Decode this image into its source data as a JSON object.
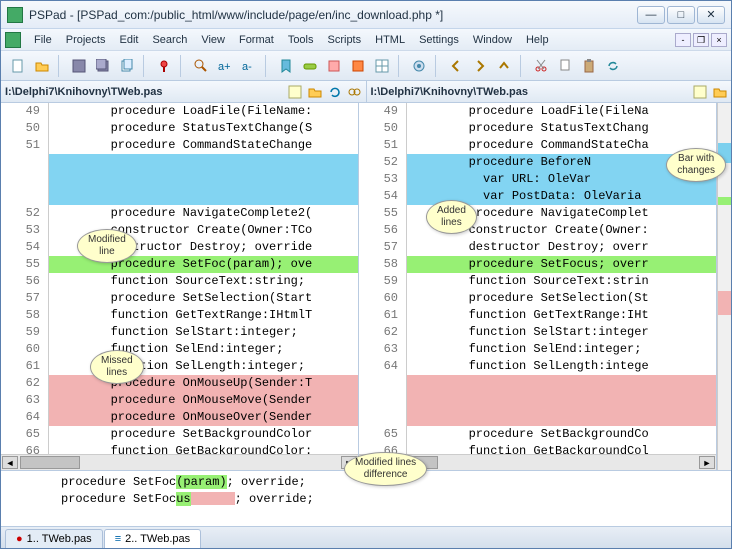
{
  "window": {
    "title": "PSPad - [PSPad_com:/public_html/www/include/page/en/inc_download.php *]"
  },
  "menu": {
    "items": [
      "File",
      "Projects",
      "Edit",
      "Search",
      "View",
      "Format",
      "Tools",
      "Scripts",
      "HTML",
      "Settings",
      "Window",
      "Help"
    ]
  },
  "paths": {
    "left": "I:\\Delphi7\\Knihovny\\TWeb.pas",
    "right": "I:\\Delphi7\\Knihovny\\TWeb.pas"
  },
  "left": {
    "lines": [
      {
        "n": "49",
        "t": "        procedure LoadFile(FileName:"
      },
      {
        "n": "50",
        "t": "        procedure StatusTextChange(S"
      },
      {
        "n": "51",
        "t": "        procedure CommandStateChange"
      },
      {
        "n": "",
        "t": " ",
        "cls": "hl-cyan"
      },
      {
        "n": "",
        "t": " ",
        "cls": "hl-cyan"
      },
      {
        "n": "",
        "t": " ",
        "cls": "hl-cyan"
      },
      {
        "n": "52",
        "t": "        procedure NavigateComplete2("
      },
      {
        "n": "53",
        "t": "        constructor Create(Owner:TCo"
      },
      {
        "n": "54",
        "t": "        destructor Destroy; override"
      },
      {
        "n": "55",
        "t": "        procedure SetFoc(param); ove",
        "cls": "hl-green"
      },
      {
        "n": "56",
        "t": "        function SourceText:string;"
      },
      {
        "n": "57",
        "t": "        procedure SetSelection(Start"
      },
      {
        "n": "58",
        "t": "        function GetTextRange:IHtmlT"
      },
      {
        "n": "59",
        "t": "        function SelStart:integer;"
      },
      {
        "n": "60",
        "t": "        function SelEnd:integer;"
      },
      {
        "n": "61",
        "t": "        function SelLength:integer;"
      },
      {
        "n": "62",
        "t": "        procedure OnMouseUp(Sender:T",
        "cls": "hl-pink"
      },
      {
        "n": "63",
        "t": "        procedure OnMouseMove(Sender",
        "cls": "hl-pink"
      },
      {
        "n": "64",
        "t": "        procedure OnMouseOver(Sender",
        "cls": "hl-pink"
      },
      {
        "n": "65",
        "t": "        procedure SetBackgroundColor"
      },
      {
        "n": "66",
        "t": "        function GetBackgroundColor:"
      }
    ]
  },
  "right": {
    "lines": [
      {
        "n": "49",
        "t": "        procedure LoadFile(FileNa"
      },
      {
        "n": "50",
        "t": "        procedure StatusTextChang"
      },
      {
        "n": "51",
        "t": "        procedure CommandStateCha"
      },
      {
        "n": "52",
        "t": "        procedure BeforeN",
        "cls": "hl-cyan"
      },
      {
        "n": "53",
        "t": "          var URL: OleVar",
        "cls": "hl-cyan"
      },
      {
        "n": "54",
        "t": "          var PostData: OleVaria",
        "cls": "hl-cyan"
      },
      {
        "n": "55",
        "t": "        procedure NavigateComplet"
      },
      {
        "n": "56",
        "t": "        constructor Create(Owner:"
      },
      {
        "n": "57",
        "t": "        destructor Destroy; overr"
      },
      {
        "n": "58",
        "t": "        procedure SetFocus; overr",
        "cls": "hl-green"
      },
      {
        "n": "59",
        "t": "        function SourceText:strin"
      },
      {
        "n": "60",
        "t": "        procedure SetSelection(St"
      },
      {
        "n": "61",
        "t": "        function GetTextRange:IHt"
      },
      {
        "n": "62",
        "t": "        function SelStart:integer"
      },
      {
        "n": "63",
        "t": "        function SelEnd:integer;"
      },
      {
        "n": "64",
        "t": "        function SelLength:intege"
      },
      {
        "n": "",
        "t": " ",
        "cls": "hl-pink"
      },
      {
        "n": "",
        "t": " ",
        "cls": "hl-pink"
      },
      {
        "n": "",
        "t": " ",
        "cls": "hl-pink"
      },
      {
        "n": "65",
        "t": "        procedure SetBackgroundCo"
      },
      {
        "n": "66",
        "t": "        function GetBackgroundCol"
      }
    ]
  },
  "diff_detail": {
    "line1_pre": "procedure SetFoc",
    "line1_hl": "(param)",
    "line1_post": "; override;",
    "line2_pre": "procedure SetFoc",
    "line2_hl": "us",
    "line2_post": "; override;"
  },
  "tabs": [
    {
      "label": "1.. TWeb.pas",
      "active": false,
      "dirty": true
    },
    {
      "label": "2.. TWeb.pas",
      "active": true,
      "dirty": false
    }
  ],
  "callouts": {
    "bar": "Bar with\nchanges",
    "added": "Added\nlines",
    "modified": "Modified\nline",
    "missed": "Missed\nlines",
    "diff": "Modified lines\ndifference"
  },
  "toolbar_icons": [
    "new",
    "open",
    "sep",
    "save",
    "saveall",
    "copy",
    "sep",
    "pin",
    "sep",
    "find",
    "zoomin",
    "zoomout",
    "sep",
    "bookmark",
    "toggle",
    "options",
    "options2",
    "grid",
    "sep",
    "settings",
    "sep",
    "prev",
    "next",
    "up",
    "sep",
    "cut",
    "copy2",
    "paste",
    "sync"
  ]
}
